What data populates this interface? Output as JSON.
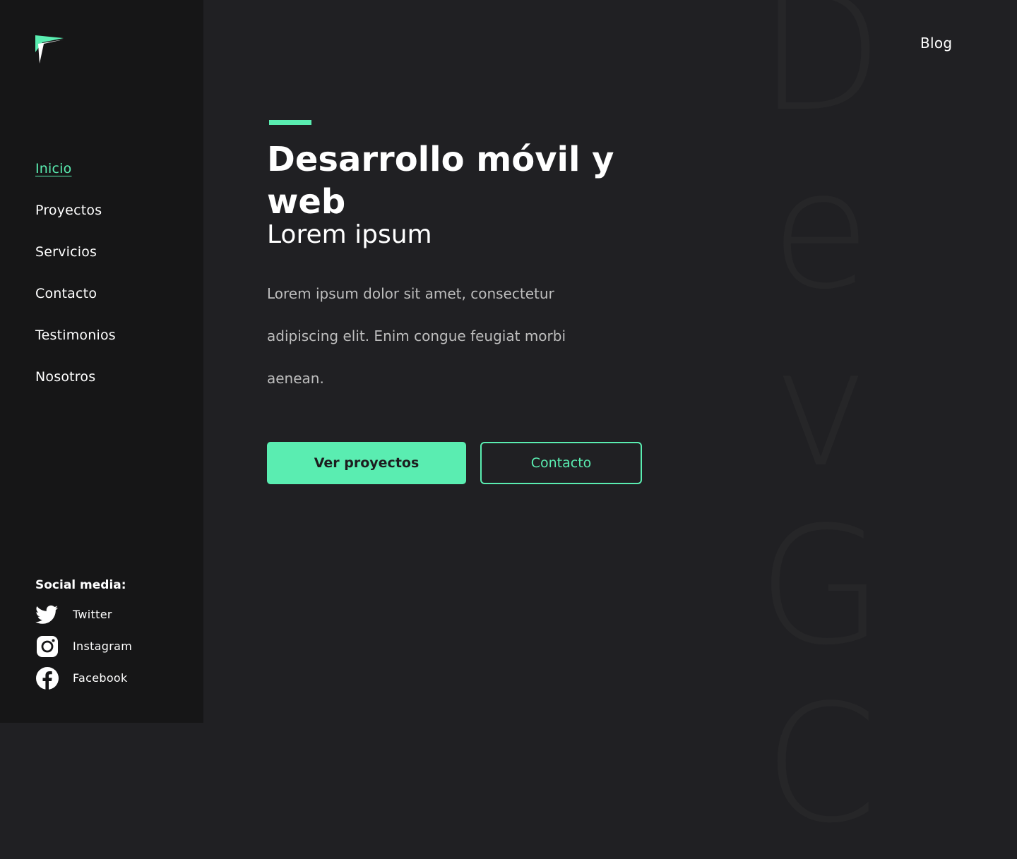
{
  "brand": {
    "logo_icon": "flag-chevron-logo-icon",
    "accent_color": "#5aedb1"
  },
  "sidebar": {
    "nav": [
      {
        "label": "Inicio",
        "active": true
      },
      {
        "label": "Proyectos",
        "active": false
      },
      {
        "label": "Servicios",
        "active": false
      },
      {
        "label": "Contacto",
        "active": false
      },
      {
        "label": "Testimonios",
        "active": false
      },
      {
        "label": "Nosotros",
        "active": false
      }
    ],
    "social_title": "Social media:",
    "social": [
      {
        "label": "Twitter",
        "icon": "twitter-icon"
      },
      {
        "label": "Instagram",
        "icon": "instagram-icon"
      },
      {
        "label": "Facebook",
        "icon": "facebook-icon"
      }
    ]
  },
  "header": {
    "blog_label": "Blog"
  },
  "watermark": [
    "D",
    "e",
    "v",
    "G",
    "C"
  ],
  "hero": {
    "title": "Desarrollo móvil y web",
    "subtitle": "Lorem ipsum",
    "body": "Lorem ipsum dolor sit amet, consectetur adipiscing elit. Enim congue feugiat morbi aenean.",
    "primary_button": "Ver proyectos",
    "secondary_button": "Contacto"
  }
}
